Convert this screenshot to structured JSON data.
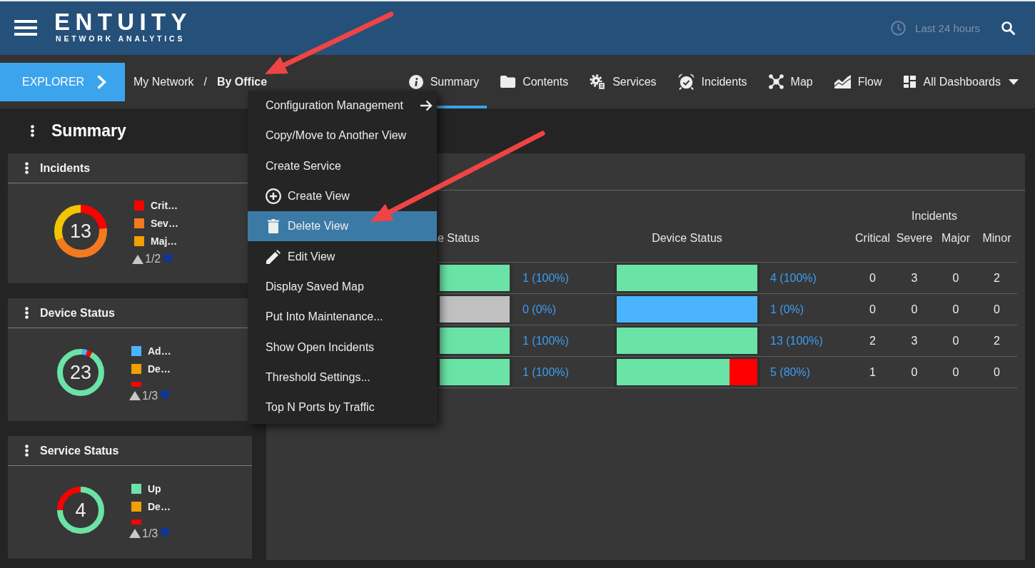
{
  "header": {
    "logo": {
      "wordmark": "ENTUITY",
      "tagline": "NETWORK ANALYTICS"
    },
    "time_range": "Last 24 hours"
  },
  "nav": {
    "explorer_button": "EXPLORER",
    "breadcrumb": {
      "separator": "/",
      "items": [
        {
          "label": "My Network",
          "current": false
        },
        {
          "label": "By Office",
          "current": true
        }
      ]
    },
    "tabs": [
      {
        "label": "Summary",
        "selected": true
      },
      {
        "label": "Contents",
        "selected": false
      },
      {
        "label": "Services",
        "selected": false
      },
      {
        "label": "Incidents",
        "selected": false
      },
      {
        "label": "Map",
        "selected": false
      },
      {
        "label": "Flow",
        "selected": false
      }
    ],
    "dashboards_menu": {
      "label": "All Dashboards"
    }
  },
  "context_menu": {
    "items": [
      {
        "label": "Configuration Management",
        "kind": "submenu",
        "selected": false
      },
      {
        "label": "Copy/Move to Another View",
        "kind": "plain",
        "selected": false
      },
      {
        "label": "Create Service",
        "kind": "plain",
        "selected": false
      },
      {
        "label": "Create View",
        "kind": "add",
        "selected": false
      },
      {
        "label": "Delete View",
        "kind": "delete",
        "selected": true
      },
      {
        "label": "Edit View",
        "kind": "edit",
        "selected": false
      },
      {
        "label": "Display Saved Map",
        "kind": "plain",
        "selected": false
      },
      {
        "label": "Put Into Maintenance...",
        "kind": "plain",
        "selected": false
      },
      {
        "label": "Show Open Incidents",
        "kind": "plain",
        "selected": false
      },
      {
        "label": "Threshold Settings...",
        "kind": "plain",
        "selected": false
      },
      {
        "label": "Top N Ports by Traffic",
        "kind": "plain",
        "selected": false
      }
    ]
  },
  "sidebar": {
    "title": "Summary",
    "cards": [
      {
        "title": "Incidents",
        "total": "13",
        "legend": [
          {
            "label": "Crit…",
            "color": "#ff0000",
            "clipped": false
          },
          {
            "label": "Sev…",
            "color": "#f47a20",
            "clipped": false
          },
          {
            "label": "Maj…",
            "color": "#f0a000",
            "clipped": false
          }
        ],
        "pager": {
          "text": "1/2",
          "prev_disabled": true,
          "next_disabled": false
        }
      },
      {
        "title": "Device Status",
        "total": "23",
        "legend": [
          {
            "label": "Ad…",
            "color": "#4ab4ff",
            "clipped": false
          },
          {
            "label": "De…",
            "color": "#f0a000",
            "clipped": false
          },
          {
            "color": "#ff0000",
            "clipped": true
          }
        ],
        "pager": {
          "text": "1/3",
          "prev_disabled": true,
          "next_disabled": false
        }
      },
      {
        "title": "Service Status",
        "total": "4",
        "legend": [
          {
            "label": "Up",
            "color": "#6ae3a6",
            "clipped": false
          },
          {
            "label": "De…",
            "color": "#f0a000",
            "clipped": false
          },
          {
            "color": "#ff0000",
            "clipped": true
          }
        ],
        "pager": {
          "text": "1/3",
          "prev_disabled": true,
          "next_disabled": false
        }
      }
    ]
  },
  "main": {
    "table": {
      "column_group": "Incidents",
      "columns": [
        "e Status",
        "Device Status",
        "Critical",
        "Severe",
        "Major",
        "Minor"
      ],
      "rows": [
        {
          "service_bar": [
            {
              "color": "#6ae3a6",
              "level": 1
            }
          ],
          "service_reading": "1 (100%)",
          "device_bar": [
            {
              "color": "#6ae3a6",
              "level": 1
            }
          ],
          "device_reading": "4 (100%)",
          "counts": [
            "0",
            "3",
            "0",
            "2"
          ]
        },
        {
          "service_bar": [
            {
              "color": "#c0c0c0",
              "level": 1
            }
          ],
          "service_reading": "0 (0%)",
          "device_bar": [
            {
              "color": "#4ab4ff",
              "level": 1
            }
          ],
          "device_reading": "1 (0%)",
          "counts": [
            "0",
            "0",
            "0",
            "0"
          ]
        },
        {
          "service_bar": [
            {
              "color": "#6ae3a6",
              "level": 1
            }
          ],
          "service_reading": "1 (100%)",
          "device_bar": [
            {
              "color": "#6ae3a6",
              "level": 1
            }
          ],
          "device_reading": "13 (100%)",
          "counts": [
            "2",
            "3",
            "0",
            "2"
          ]
        },
        {
          "service_bar": [
            {
              "color": "#6ae3a6",
              "level": 1
            }
          ],
          "service_reading": "1 (100%)",
          "device_bar": [
            {
              "color": "#6ae3a6",
              "level": 0.8
            },
            {
              "color": "#ff0000",
              "level": 0.2
            }
          ],
          "device_reading": "5 (80%)",
          "counts": [
            "1",
            "0",
            "0",
            "0"
          ]
        }
      ]
    }
  }
}
